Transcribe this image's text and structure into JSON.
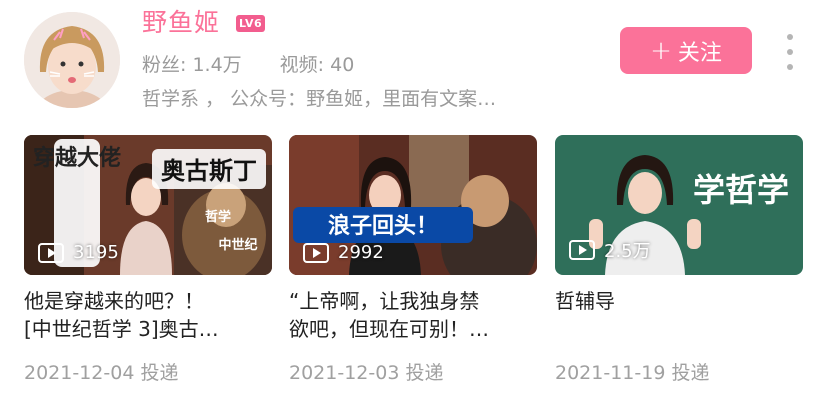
{
  "profile": {
    "name": "野鱼姬",
    "level": "LV6",
    "fans_label": "粉丝: 1.4万",
    "videos_label": "视频: 40",
    "bio": "哲学系 ， 公众号：野鱼姬，里面有文案…",
    "follow_label": "关注",
    "follow_icon": "plus-icon",
    "more_icon": "more-vertical-icon"
  },
  "colors": {
    "accent": "#fb7299",
    "level_badge": "#f25d8e",
    "muted_text": "#9a9a9a",
    "more_dots": "#b5b5b5"
  },
  "videos": [
    {
      "title_line1": "他是穿越来的吧？！",
      "title_line2": "[中世纪哲学 3]奥古…",
      "plays": "3195",
      "date": "2021-12-04 投递",
      "thumb_text_1": "穿越大佬",
      "thumb_text_2": "奥古斯丁",
      "thumb_text_3": "哲学",
      "thumb_text_4": "中世纪"
    },
    {
      "title_line1": "“上帝啊，让我独身禁",
      "title_line2": "欲吧，但现在可别！…",
      "plays": "2992",
      "date": "2021-12-03 投递",
      "thumb_text_1": "浪子回头！"
    },
    {
      "title_line1": "哲辅导",
      "title_line2": "",
      "plays": "2.5万",
      "date": "2021-11-19 投递",
      "thumb_text_1": "学哲学"
    }
  ]
}
